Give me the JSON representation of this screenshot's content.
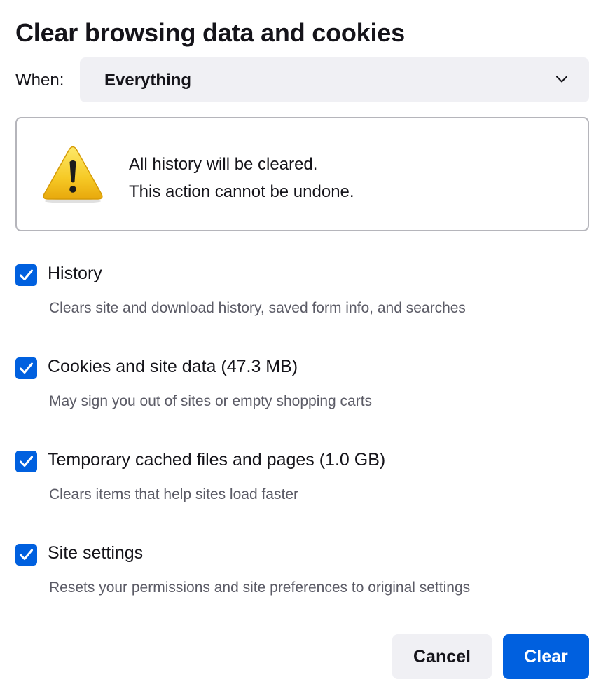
{
  "dialog": {
    "title": "Clear browsing data and cookies"
  },
  "when": {
    "label": "When:",
    "selected": "Everything",
    "icon": "chevron-down-icon"
  },
  "warning": {
    "icon": "warning-icon",
    "line1": "All history will be cleared.",
    "line2": "This action cannot be undone."
  },
  "options": [
    {
      "label": "History",
      "description": "Clears site and download history, saved form info, and searches",
      "checked": true
    },
    {
      "label": "Cookies and site data (47.3 MB)",
      "description": "May sign you out of sites or empty shopping carts",
      "checked": true
    },
    {
      "label": "Temporary cached files and pages (1.0 GB)",
      "description": "Clears items that help sites load faster",
      "checked": true
    },
    {
      "label": "Site settings",
      "description": "Resets your permissions and site preferences to original settings",
      "checked": true
    }
  ],
  "buttons": {
    "cancel": "Cancel",
    "clear": "Clear"
  },
  "colors": {
    "accent": "#0060df",
    "button_secondary_bg": "#f0f0f4",
    "text_primary": "#15141a",
    "text_secondary": "#5b5b66",
    "border": "#b5b5bb",
    "warning_yellow": "#f5c400"
  }
}
